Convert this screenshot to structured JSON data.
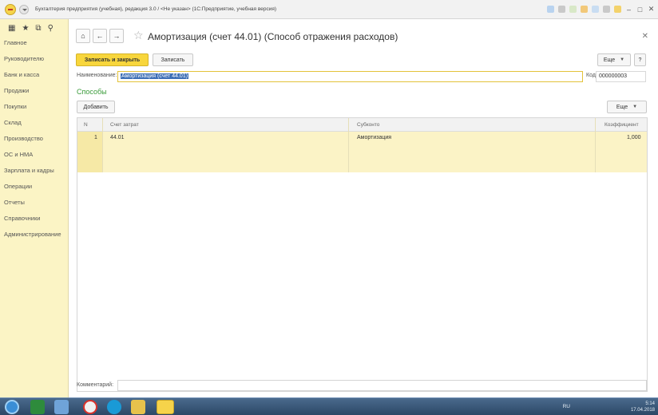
{
  "window": {
    "title": "Бухгалтерия предприятия (учебная), редакция 3.0 / <Не указан> (1С:Предприятие, учебная версия)",
    "controls": [
      "–",
      "□",
      "✕"
    ]
  },
  "sidebar": {
    "items": [
      {
        "label": "Главное"
      },
      {
        "label": "Руководителю"
      },
      {
        "label": "Банк и касса"
      },
      {
        "label": "Продажи"
      },
      {
        "label": "Покупки"
      },
      {
        "label": "Склад"
      },
      {
        "label": "Производство"
      },
      {
        "label": "ОС и НМА"
      },
      {
        "label": "Зарплата и кадры"
      },
      {
        "label": "Операции"
      },
      {
        "label": "Отчеты"
      },
      {
        "label": "Справочники"
      },
      {
        "label": "Администрирование"
      }
    ]
  },
  "form": {
    "title": "Амортизация (счет 44.01) (Способ отражения расходов)",
    "save_close_label": "Записать и закрыть",
    "save_label": "Записать",
    "more_label": "Еще",
    "help_label": "?",
    "name_label": "Наименование:",
    "name_value": "Амортизация (счет 44.01)",
    "code_label": "Код:",
    "code_value": "000000003",
    "section_title": "Способы",
    "add_label": "Добавить",
    "table_more_label": "Еще",
    "comment_label": "Комментарий:",
    "comment_value": ""
  },
  "table": {
    "columns": [
      "N",
      "Счет затрат",
      "Субконто",
      "Коэффициент"
    ],
    "rows": [
      {
        "n": "1",
        "account": "44.01",
        "subconto": "Амортизация",
        "coef": "1,000"
      }
    ]
  },
  "taskbar": {
    "lang": "RU",
    "time": "5:14",
    "date": "17.04.2018"
  },
  "colors": {
    "accent": "#f8d63c",
    "sidebar": "#fbf4c5",
    "section": "#3a9b3a"
  }
}
